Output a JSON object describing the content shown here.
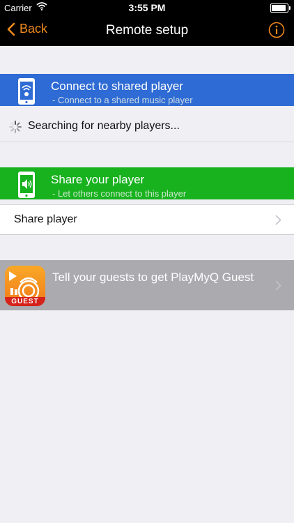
{
  "status": {
    "carrier": "Carrier",
    "time": "3:55 PM"
  },
  "nav": {
    "back_label": "Back",
    "title": "Remote setup"
  },
  "connect_section": {
    "title": "Connect to shared player",
    "subtitle": "- Connect to a shared music player",
    "color": "#2f6bd4",
    "status_text": "Searching for nearby players..."
  },
  "share_section": {
    "title": "Share your player",
    "subtitle": "- Let others connect to this player",
    "color": "#18b21f",
    "row_label": "Share player"
  },
  "guest_row": {
    "text": "Tell your guests to get PlayMyQ Guest",
    "badge": "GUEST"
  },
  "colors": {
    "accent": "#f08a1e",
    "background": "#efeff4"
  }
}
